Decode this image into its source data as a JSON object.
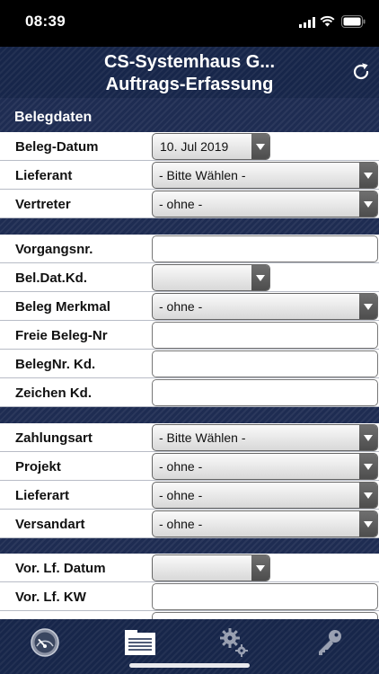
{
  "status": {
    "time": "08:39"
  },
  "header": {
    "title_line1": "CS-Systemhaus G...",
    "title_line2": "Auftrags-Erfassung"
  },
  "section": {
    "title": "Belegdaten"
  },
  "fields": {
    "beleg_datum": {
      "label": "Beleg-Datum",
      "value": "10. Jul 2019"
    },
    "lieferant": {
      "label": "Lieferant",
      "value": "- Bitte Wählen -"
    },
    "vertreter": {
      "label": "Vertreter",
      "value": "- ohne -"
    },
    "vorgangsnr": {
      "label": "Vorgangsnr.",
      "value": ""
    },
    "bel_dat_kd": {
      "label": "Bel.Dat.Kd.",
      "value": ""
    },
    "beleg_merkmal": {
      "label": "Beleg Merkmal",
      "value": "- ohne -"
    },
    "freie_beleg_nr": {
      "label": "Freie Beleg-Nr",
      "value": ""
    },
    "belegnr_kd": {
      "label": "BelegNr. Kd.",
      "value": ""
    },
    "zeichen_kd": {
      "label": "Zeichen Kd.",
      "value": ""
    },
    "zahlungsart": {
      "label": "Zahlungsart",
      "value": "- Bitte Wählen -"
    },
    "projekt": {
      "label": "Projekt",
      "value": "- ohne -"
    },
    "lieferart": {
      "label": "Lieferart",
      "value": "- ohne -"
    },
    "versandart": {
      "label": "Versandart",
      "value": "- ohne -"
    },
    "vor_lf_datum": {
      "label": "Vor. Lf. Datum",
      "value": ""
    },
    "vor_lf_kw": {
      "label": "Vor. Lf. KW",
      "value": ""
    }
  },
  "tabbar": {
    "items": [
      {
        "icon": "speedometer-icon"
      },
      {
        "icon": "document-list-icon",
        "selected": true
      },
      {
        "icon": "gears-icon"
      },
      {
        "icon": "key-icon"
      }
    ]
  },
  "colors": {
    "header_bg": "#17264a",
    "row_border": "#b8bcc6",
    "text": "#111111"
  }
}
